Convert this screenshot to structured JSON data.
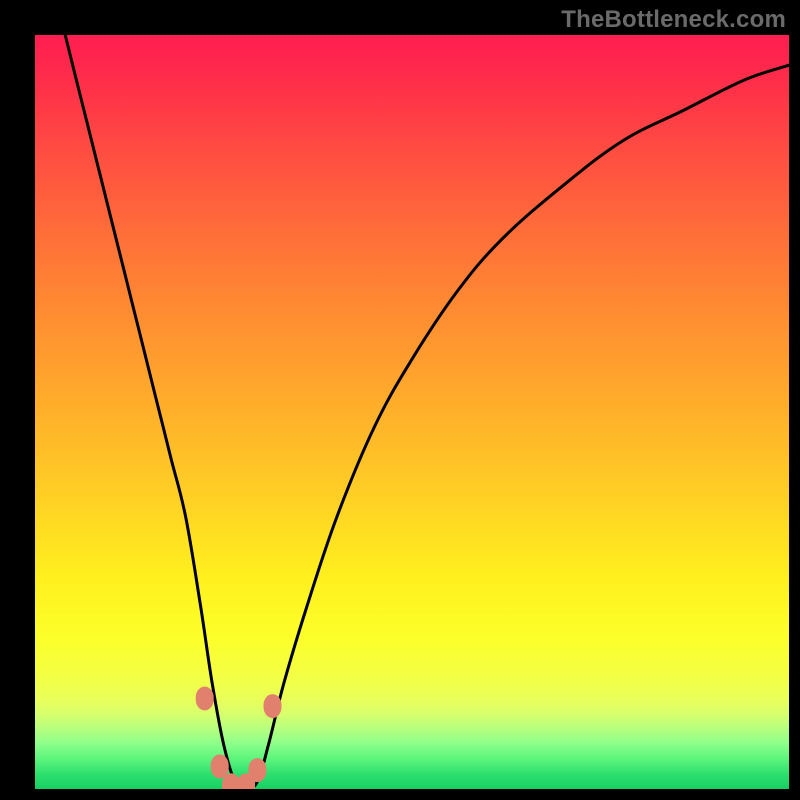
{
  "watermark": {
    "text": "TheBottleneck.com"
  },
  "colors": {
    "background": "#000000",
    "curve_stroke": "#000000",
    "marker_fill": "#e2806e",
    "gradient_stops": [
      "#ff1e50",
      "#ff6a3a",
      "#ffb02a",
      "#fff01e",
      "#b6ff7e",
      "#17d062"
    ]
  },
  "chart_data": {
    "type": "line",
    "title": "",
    "xlabel": "",
    "ylabel": "",
    "xlim": [
      0,
      100
    ],
    "ylim": [
      0,
      100
    ],
    "grid": false,
    "legend": false,
    "series": [
      {
        "name": "bottleneck-curve",
        "x": [
          4,
          6,
          8,
          10,
          12,
          14,
          16,
          18,
          20,
          22,
          23.5,
          25,
          26.5,
          28,
          29.5,
          31,
          33,
          36,
          40,
          45,
          50,
          56,
          62,
          70,
          78,
          86,
          94,
          100
        ],
        "y": [
          100,
          92,
          84,
          76,
          68,
          60,
          52,
          44,
          36,
          24,
          14,
          6,
          1,
          0,
          1,
          6,
          14,
          24,
          36,
          48,
          57,
          66,
          73,
          80,
          86,
          90,
          94,
          96
        ]
      }
    ],
    "markers": [
      {
        "x": 22.5,
        "y": 12
      },
      {
        "x": 24.5,
        "y": 3
      },
      {
        "x": 26.0,
        "y": 0.5
      },
      {
        "x": 28.0,
        "y": 0.5
      },
      {
        "x": 29.5,
        "y": 2.5
      },
      {
        "x": 31.5,
        "y": 11
      }
    ],
    "notch_x": 27
  }
}
